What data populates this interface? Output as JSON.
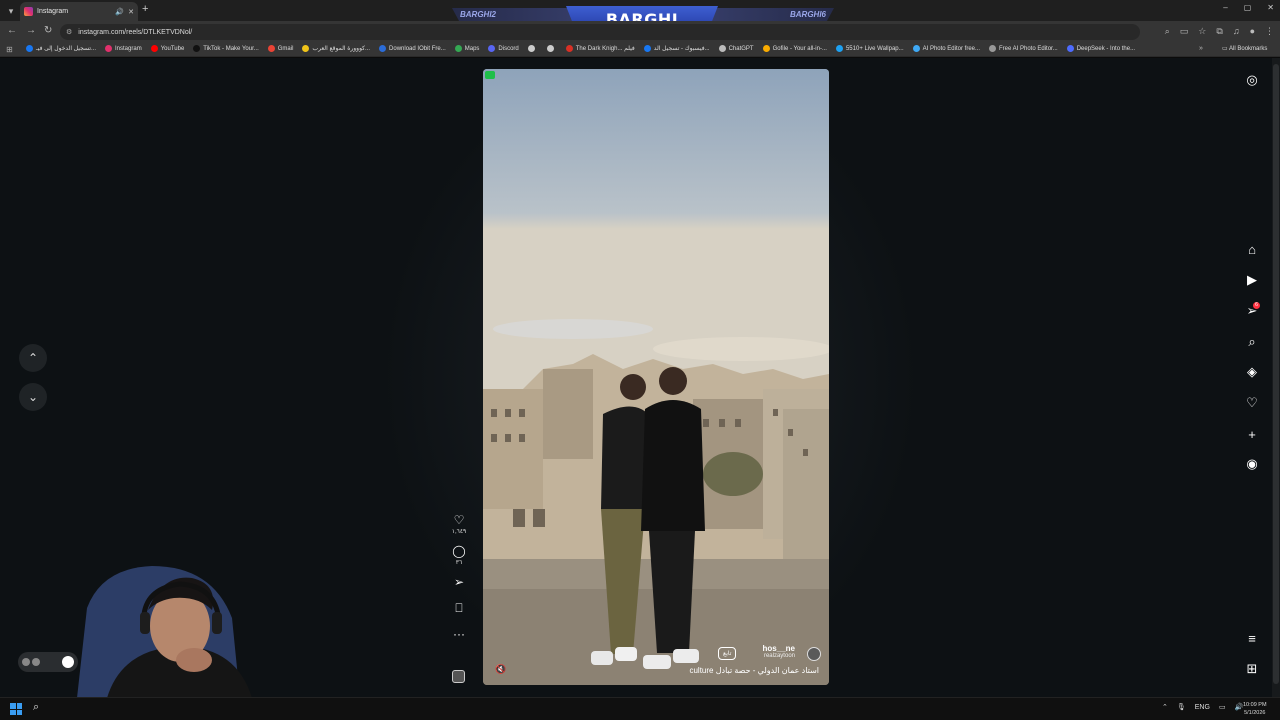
{
  "browser": {
    "tab": {
      "title": "Instagram"
    },
    "window_controls": [
      "–",
      "▢",
      "✕"
    ],
    "url": "instagram.com/reels/DTLKETVDNol/",
    "bookmarks": [
      {
        "label": "تسجيل الدخول إلى فيـ...",
        "color": "#1877f2"
      },
      {
        "label": "Instagram",
        "color": "#e1306c"
      },
      {
        "label": "YouTube",
        "color": "#ff0000"
      },
      {
        "label": "TikTok - Make Your...",
        "color": "#111111"
      },
      {
        "label": "Gmail",
        "color": "#ea4335"
      },
      {
        "label": "كووورة الموقع العرب...",
        "color": "#f0c419"
      },
      {
        "label": "Download IObit Fre...",
        "color": "#2b6cd8"
      },
      {
        "label": "Maps",
        "color": "#34a853"
      },
      {
        "label": "Discord",
        "color": "#5865f2"
      },
      {
        "label": "",
        "color": "#cccccc"
      },
      {
        "label": "",
        "color": "#cccccc"
      },
      {
        "label": "The Dark Knigh... فيلم",
        "color": "#d93025"
      },
      {
        "label": "فيسبوك - تسجيل الد...",
        "color": "#1877f2"
      },
      {
        "label": "ChatGPT",
        "color": "#bbbbbb"
      },
      {
        "label": "Gofile - Your all-in-...",
        "color": "#f9ab00"
      },
      {
        "label": "5510+ Live Wallpap...",
        "color": "#1da1f2"
      },
      {
        "label": "AI Photo Editor free...",
        "color": "#3fa9f5"
      },
      {
        "label": "Free AI Photo Editor...",
        "color": "#999999"
      },
      {
        "label": "DeepSeek - Into the...",
        "color": "#4d6bfe"
      }
    ],
    "all_bookmarks": "All Bookmarks"
  },
  "stream_banner": {
    "left": "BARGHI2",
    "center": "BARGHI",
    "right": "BARGHI6"
  },
  "reel": {
    "likes": "١,٦٤٩",
    "comments": "٣٦",
    "username": "hos__ne",
    "audio_user": "realzaytoon",
    "follow_label": "تابع",
    "caption": "culture استاد عمان الدولي - حصة تبادل"
  },
  "taskbar": {
    "lang": "ENG",
    "time": "10:09 PM",
    "date": "5/1/2026"
  },
  "colors": {
    "accent": "#e1306c",
    "badge": "#ff3040"
  }
}
